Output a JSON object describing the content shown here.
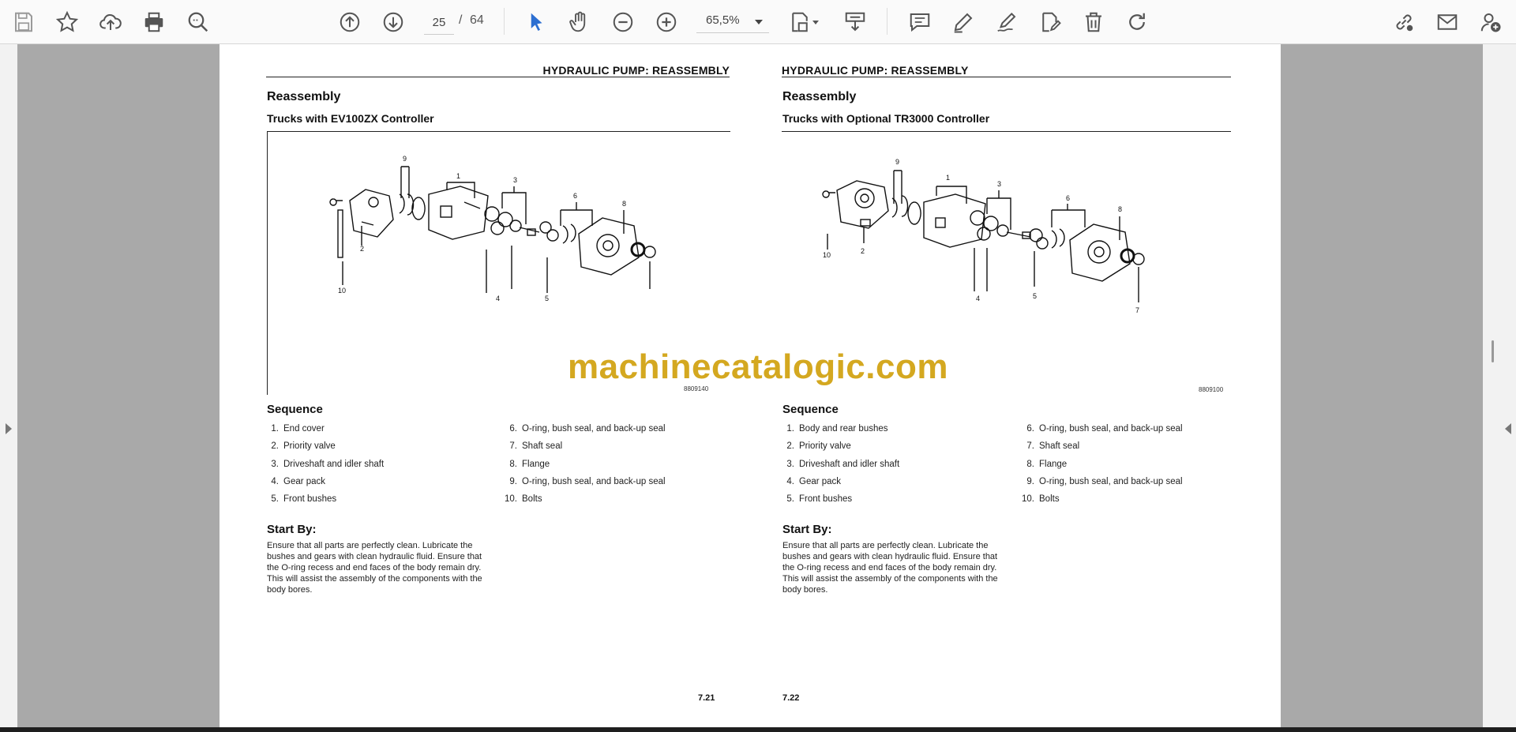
{
  "toolbar": {
    "page_current": "25",
    "page_separator": "/",
    "page_total": "64",
    "zoom": "65,5%",
    "icons": [
      "save-icon",
      "star-icon",
      "upload-icon",
      "print-icon",
      "zoom-search-icon",
      "prev-page-icon",
      "next-page-icon",
      "select-cursor-icon",
      "hand-tool-icon",
      "zoom-out-icon",
      "zoom-in-icon",
      "page-fit-icon",
      "scroll-mode-icon",
      "comment-icon",
      "pen-icon",
      "sign-icon",
      "edit-icon",
      "delete-icon",
      "rotate-icon",
      "share-link-icon",
      "mail-icon",
      "add-user-icon"
    ]
  },
  "left_page": {
    "header": "HYDRAULIC PUMP: REASSEMBLY",
    "title": "Reassembly",
    "subtitle": "Trucks with EV100ZX Controller",
    "figure_code": "8809140",
    "callouts": [
      "9",
      "1",
      "3",
      "6",
      "8",
      "2",
      "10",
      "4",
      "5"
    ],
    "sequence_title": "Sequence",
    "sequence_col1": [
      {
        "n": "1.",
        "t": "End cover"
      },
      {
        "n": "2.",
        "t": "Priority valve"
      },
      {
        "n": "3.",
        "t": "Driveshaft and idler shaft"
      },
      {
        "n": "4.",
        "t": "Gear pack"
      },
      {
        "n": "5.",
        "t": "Front bushes"
      }
    ],
    "sequence_col2": [
      {
        "n": "6.",
        "t": "O-ring, bush seal, and back-up seal"
      },
      {
        "n": "7.",
        "t": "Shaft seal"
      },
      {
        "n": "8.",
        "t": "Flange"
      },
      {
        "n": "9.",
        "t": "O-ring, bush seal, and back-up seal"
      },
      {
        "n": "10.",
        "t": "Bolts"
      }
    ],
    "start_title": "Start By:",
    "start_body": "Ensure that all parts are perfectly clean. Lubricate the bushes and gears with clean hydraulic fluid. Ensure that the O-ring recess and end faces of the body remain dry. This will assist the assembly of the components with the body bores.",
    "page_number": "7.21"
  },
  "right_page": {
    "header": "HYDRAULIC PUMP: REASSEMBLY",
    "title": "Reassembly",
    "subtitle": "Trucks with Optional TR3000 Controller",
    "figure_code": "8809100",
    "callouts": [
      "9",
      "1",
      "3",
      "6",
      "8",
      "10",
      "2",
      "4",
      "5",
      "7"
    ],
    "sequence_title": "Sequence",
    "sequence_col1": [
      {
        "n": "1.",
        "t": "Body and rear bushes"
      },
      {
        "n": "2.",
        "t": "Priority valve"
      },
      {
        "n": "3.",
        "t": "Driveshaft and idler shaft"
      },
      {
        "n": "4.",
        "t": "Gear pack"
      },
      {
        "n": "5.",
        "t": "Front bushes"
      }
    ],
    "sequence_col2": [
      {
        "n": "6.",
        "t": "O-ring, bush seal, and back-up seal"
      },
      {
        "n": "7.",
        "t": "Shaft seal"
      },
      {
        "n": "8.",
        "t": "Flange"
      },
      {
        "n": "9.",
        "t": "O-ring, bush seal, and back-up seal"
      },
      {
        "n": "10.",
        "t": "Bolts"
      }
    ],
    "start_title": "Start By:",
    "start_body": "Ensure that all parts are perfectly clean. Lubricate the bushes and gears with clean hydraulic fluid. Ensure that the O-ring recess and end faces of the body remain dry. This will assist the assembly of the components with the body bores.",
    "page_number": "7.22"
  },
  "watermark": "machinecatalogic.com",
  "colors": {
    "toolbar_bg": "#fafafa",
    "viewer_bg": "#a9a9a9",
    "accent": "#2c6fd1",
    "watermark": "#d4a820"
  }
}
